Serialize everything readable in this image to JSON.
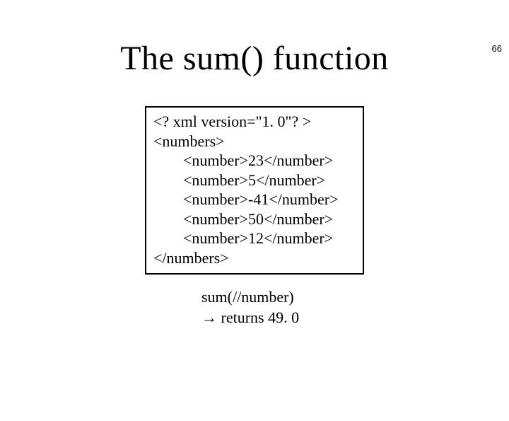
{
  "page_number": "66",
  "title": "The sum() function",
  "code": {
    "l1": "<? xml version=\"1. 0\"? >",
    "l2": "<numbers>",
    "l3": "<number>23</number>",
    "l4": "<number>5</number>",
    "l5": "<number>-41</number>",
    "l6": "<number>50</number>",
    "l7": "<number>12</number>",
    "l8": "</numbers>"
  },
  "result": {
    "r1": "sum(//number)",
    "r2": "→ returns 49. 0"
  }
}
